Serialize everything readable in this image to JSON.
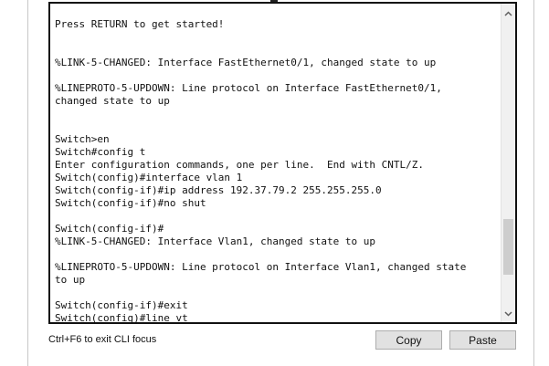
{
  "terminal": {
    "lines": [
      "Press RETURN to get started!",
      "",
      "",
      "%LINK-5-CHANGED: Interface FastEthernet0/1, changed state to up",
      "",
      "%LINEPROTO-5-UPDOWN: Line protocol on Interface FastEthernet0/1,",
      "changed state to up",
      "",
      "",
      "Switch>en",
      "Switch#config t",
      "Enter configuration commands, one per line.  End with CNTL/Z.",
      "Switch(config)#interface vlan 1",
      "Switch(config-if)#ip address 192.37.79.2 255.255.255.0",
      "Switch(config-if)#no shut",
      "",
      "Switch(config-if)#",
      "%LINK-5-CHANGED: Interface Vlan1, changed state to up",
      "",
      "%LINEPROTO-5-UPDOWN: Line protocol on Interface Vlan1, changed state",
      "to up",
      "",
      "Switch(config-if)#exit",
      "Switch(config)#line vt"
    ],
    "scroll_position": 0.88,
    "scroll_thumb_fraction": 0.2
  },
  "footer": {
    "hint": "Ctrl+F6 to exit CLI focus",
    "copy_label": "Copy",
    "paste_label": "Paste"
  },
  "icons": {
    "scroll_up": "chevron-up-icon",
    "scroll_down": "chevron-down-icon"
  }
}
